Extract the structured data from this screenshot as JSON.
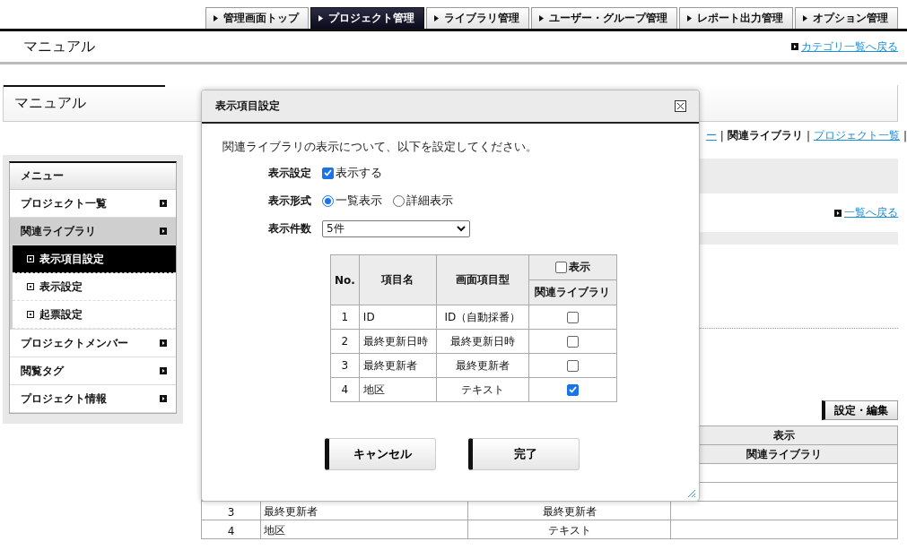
{
  "top_nav": {
    "tabs": [
      {
        "label": "管理画面トップ",
        "selected": false
      },
      {
        "label": "プロジェクト管理",
        "selected": true
      },
      {
        "label": "ライブラリ管理",
        "selected": false
      },
      {
        "label": "ユーザー・グループ管理",
        "selected": false
      },
      {
        "label": "レポート出力管理",
        "selected": false
      },
      {
        "label": "オプション管理",
        "selected": false
      }
    ]
  },
  "page_header": {
    "title": "マニュアル",
    "back_link": "カテゴリ一覧へ戻る"
  },
  "panel": {
    "title": "マニュアル"
  },
  "sidebar": {
    "heading": "メニュー",
    "items": [
      {
        "label": "プロジェクト一覧",
        "selected": false
      },
      {
        "label": "関連ライブラリ",
        "selected": true,
        "children": [
          {
            "label": "表示項目設定",
            "selected": true
          },
          {
            "label": "表示設定",
            "selected": false
          },
          {
            "label": "起票設定",
            "selected": false
          }
        ]
      },
      {
        "label": "プロジェクトメンバー",
        "selected": false
      },
      {
        "label": "閲覧タグ",
        "selected": false
      },
      {
        "label": "プロジェクト情報",
        "selected": false
      }
    ]
  },
  "breadcrumb": [
    {
      "kind": "link",
      "label": "ー"
    },
    {
      "kind": "separator",
      "label": "|"
    },
    {
      "kind": "current",
      "label": "関連ライブラリ"
    },
    {
      "kind": "separator",
      "label": "|"
    },
    {
      "kind": "link",
      "label": "プロジェクト一覧"
    },
    {
      "kind": "separator",
      "label": "|"
    }
  ],
  "list_back_link": "一覧へ戻る",
  "edit_button": "設定・編集",
  "background_table": {
    "header_top": "表示",
    "header_bottom": "関連ライブラリ",
    "rows": [
      {
        "no": "3",
        "name": "最終更新者",
        "type": "最終更新者"
      },
      {
        "no": "4",
        "name": "地区",
        "type": "テキスト"
      }
    ]
  },
  "dialog": {
    "title": "表示項目設定",
    "intro": "関連ライブラリの表示について、以下を設定してください。",
    "display_setting": {
      "label": "表示設定",
      "option": "表示する",
      "checked": true
    },
    "display_format": {
      "label": "表示形式",
      "options": [
        {
          "label": "一覧表示",
          "selected": true
        },
        {
          "label": "詳細表示",
          "selected": false
        }
      ]
    },
    "display_count": {
      "label": "表示件数",
      "value": "5件"
    },
    "table": {
      "columns": [
        "No.",
        "項目名",
        "画面項目型"
      ],
      "group_header": {
        "label": "表示",
        "checked": false
      },
      "sub_header": "関連ライブラリ",
      "rows": [
        {
          "no": "1",
          "name": "ID",
          "type": "ID（自動採番）",
          "checked": false
        },
        {
          "no": "2",
          "name": "最終更新日時",
          "type": "最終更新日時",
          "checked": false
        },
        {
          "no": "3",
          "name": "最終更新者",
          "type": "最終更新者",
          "checked": false
        },
        {
          "no": "4",
          "name": "地区",
          "type": "テキスト",
          "checked": true
        }
      ]
    },
    "buttons": [
      "キャンセル",
      "完了"
    ]
  }
}
